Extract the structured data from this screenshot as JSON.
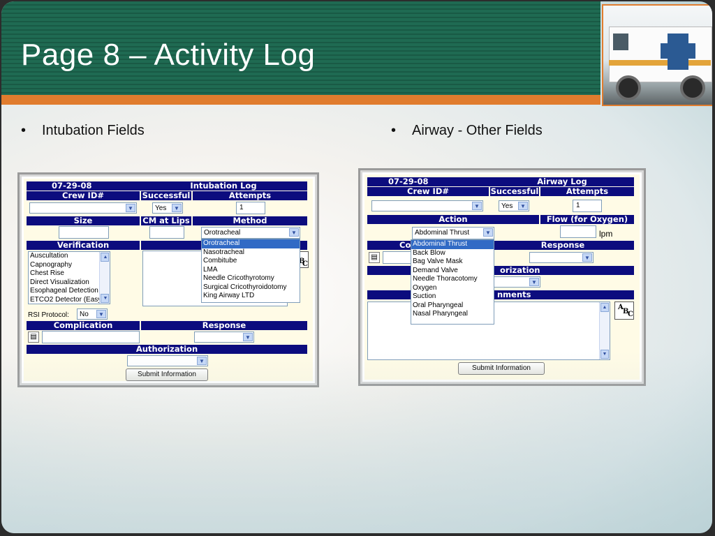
{
  "title": "Page 8 – Activity Log",
  "bullets": {
    "left": "Intubation Fields",
    "right": "Airway - Other Fields"
  },
  "intubation": {
    "date": "07-29-08",
    "log_title": "Intubation Log",
    "crew_label": "Crew ID#",
    "successful_label": "Successful",
    "attempts_label": "Attempts",
    "successful_value": "Yes",
    "attempts_value": "1",
    "size_label": "Size",
    "cm_label": "CM at Lips",
    "method_label": "Method",
    "method_value": "Orotracheal",
    "method_options": [
      "Orotracheal",
      "Nasotracheal",
      "Combitube",
      "LMA",
      "Needle Cricothyrotomy",
      "Surgical Cricothyroidotomy",
      "King Airway LTD"
    ],
    "verification_label": "Verification",
    "verification_options": [
      "Auscultation",
      "Capnography",
      "Chest Rise",
      "Direct Visualization",
      "Esophageal Detection",
      "ETCO2 Detector (Easy"
    ],
    "rsi_label": "RSI Protocol:",
    "rsi_value": "No",
    "complication_label": "Complication",
    "response_label": "Response",
    "authorization_label": "Authorization",
    "submit_label": "Submit Information"
  },
  "airway": {
    "date": "07-29-08",
    "log_title": "Airway Log",
    "crew_label": "Crew ID#",
    "successful_label": "Successful",
    "attempts_label": "Attempts",
    "successful_value": "Yes",
    "attempts_value": "1",
    "action_label": "Action",
    "flow_label": "Flow (for Oxygen)",
    "action_value": "Abdominal Thrust",
    "flow_unit": "lpm",
    "action_options": [
      "Abdominal Thrust",
      "Back Blow",
      "Bag Valve Mask",
      "Demand Valve",
      "Needle Thoracotomy",
      "Oxygen",
      "Suction",
      "Oral Pharyngeal",
      "Nasal Pharyngeal"
    ],
    "complication_label_partial": "Co",
    "response_label": "Response",
    "authorization_label_partial": "orization",
    "comments_label_partial": "nments",
    "submit_label": "Submit Information"
  },
  "icons": {
    "bullet": "bullet-dot",
    "dropdown": "chevron-down-icon",
    "notes": "clipboard-icon",
    "spell": "spellcheck-abc-icon"
  },
  "colors": {
    "banner": "#1f6a52",
    "accent": "#e07c2e",
    "header_bar": "#0c0c7e",
    "form_bg": "#fffbe6",
    "highlight": "#316ac5"
  }
}
